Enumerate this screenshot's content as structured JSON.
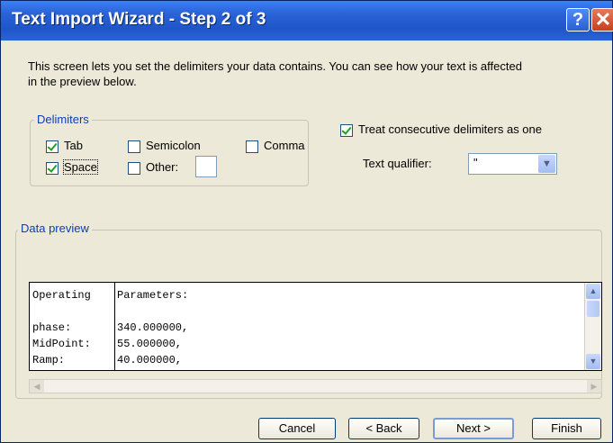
{
  "window": {
    "title": "Text Import Wizard - Step 2 of 3",
    "help_glyph": "?",
    "close_glyph": "✕"
  },
  "intro_text": "This screen lets you set the delimiters your data contains.  You can see how your text is affected in the preview below.",
  "delimiters": {
    "group_label": "Delimiters",
    "tab": {
      "label": "Tab",
      "checked": true
    },
    "semicolon": {
      "label": "Semicolon",
      "checked": false
    },
    "comma": {
      "label": "Comma",
      "checked": false
    },
    "space": {
      "label": "Space",
      "checked": true
    },
    "other": {
      "label": "Other:",
      "checked": false,
      "value": ""
    }
  },
  "consecutive": {
    "label": "Treat consecutive delimiters as one",
    "checked": true
  },
  "qualifier": {
    "label": "Text qualifier:",
    "value": "\""
  },
  "preview": {
    "group_label": "Data preview",
    "rows": [
      {
        "c1": "Operating",
        "c2": "Parameters:"
      },
      {
        "c1": "",
        "c2": ""
      },
      {
        "c1": "phase:",
        "c2": "340.000000,"
      },
      {
        "c1": "MidPoint:",
        "c2": "55.000000,"
      },
      {
        "c1": "Ramp:",
        "c2": "40.000000,"
      }
    ]
  },
  "buttons": {
    "cancel": "Cancel",
    "back": "< Back",
    "next": "Next >",
    "finish": "Finish"
  },
  "colors": {
    "title_bar": "#2a64d8",
    "group_label": "#0b3fb0",
    "check_mark": "#21a121"
  }
}
